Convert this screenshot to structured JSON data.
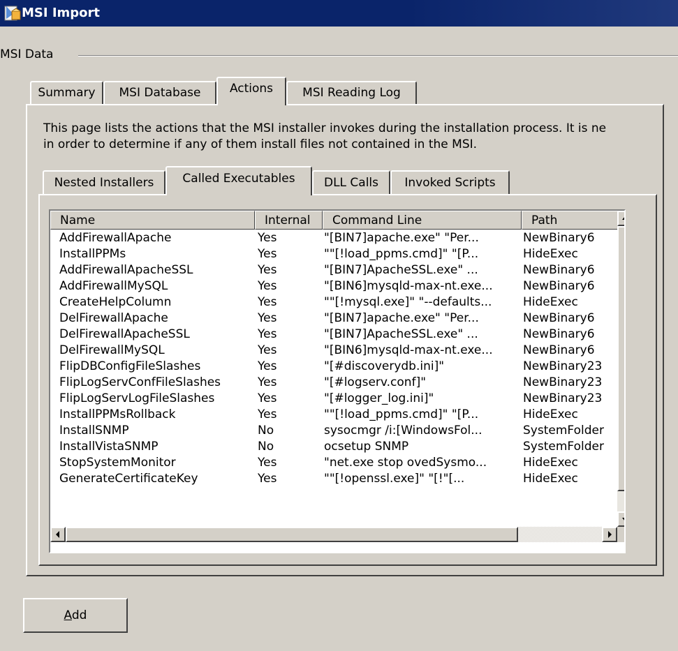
{
  "window": {
    "title": "MSI Import"
  },
  "groupbox": {
    "label": "MSI Data"
  },
  "outer_tabs": [
    {
      "label": "Summary",
      "selected": false
    },
    {
      "label": "MSI Database",
      "selected": false
    },
    {
      "label": "Actions",
      "selected": true
    },
    {
      "label": "MSI Reading Log",
      "selected": false
    }
  ],
  "description": {
    "line1": "This page lists the actions that the MSI installer invokes during the installation process.  It is ne",
    "line2": "in order to determine if any of them install files not contained in the MSI."
  },
  "inner_tabs": [
    {
      "label": "Nested Installers",
      "selected": false
    },
    {
      "label": "Called Executables",
      "selected": true
    },
    {
      "label": "DLL Calls",
      "selected": false
    },
    {
      "label": "Invoked Scripts",
      "selected": false
    }
  ],
  "table": {
    "columns": [
      "Name",
      "Internal",
      "Command Line",
      "Path"
    ],
    "rows": [
      [
        "AddFirewallApache",
        "Yes",
        "\"[BIN7]apache.exe\" \"Per...",
        "NewBinary6"
      ],
      [
        "InstallPPMs",
        "Yes",
        "\"\"[!load_ppms.cmd]\" \"[P...",
        "HideExec"
      ],
      [
        "AddFirewallApacheSSL",
        "Yes",
        "\"[BIN7]ApacheSSL.exe\" ...",
        "NewBinary6"
      ],
      [
        "AddFirewallMySQL",
        "Yes",
        "\"[BIN6]mysqld-max-nt.exe...",
        "NewBinary6"
      ],
      [
        "CreateHelpColumn",
        "Yes",
        "\"\"[!mysql.exe]\" \"--defaults...",
        "HideExec"
      ],
      [
        "DelFirewallApache",
        "Yes",
        "\"[BIN7]apache.exe\" \"Per...",
        "NewBinary6"
      ],
      [
        "DelFirewallApacheSSL",
        "Yes",
        "\"[BIN7]ApacheSSL.exe\" ...",
        "NewBinary6"
      ],
      [
        "DelFirewallMySQL",
        "Yes",
        "\"[BIN6]mysqld-max-nt.exe...",
        "NewBinary6"
      ],
      [
        "FlipDBConfigFileSlashes",
        "Yes",
        "\"[#discoverydb.ini]\"",
        "NewBinary23"
      ],
      [
        "FlipLogServConfFileSlashes",
        "Yes",
        "\"[#logserv.conf]\"",
        "NewBinary23"
      ],
      [
        "FlipLogServLogFileSlashes",
        "Yes",
        "\"[#logger_log.ini]\"",
        "NewBinary23"
      ],
      [
        "InstallPPMsRollback",
        "Yes",
        "\"\"[!load_ppms.cmd]\" \"[P...",
        "HideExec"
      ],
      [
        "InstallSNMP",
        "No",
        "sysocmgr /i:[WindowsFol...",
        "SystemFolder"
      ],
      [
        "InstallVistaSNMP",
        "No",
        "ocsetup SNMP",
        "SystemFolder"
      ],
      [
        "StopSystemMonitor",
        "Yes",
        "\"net.exe stop ovedSysmo...",
        "HideExec"
      ],
      [
        "GenerateCertificateKey",
        "Yes",
        "\"\"[!openssl.exe]\" \"[!\"[...",
        "HideExec"
      ]
    ],
    "vscroll_position": 0.0,
    "hscroll_position": 0.0
  },
  "buttons": {
    "add_label": "Add",
    "add_mnemonic": "A",
    "add_rest": "dd"
  },
  "icons": {
    "window": "msi-package-icon",
    "scroll_up": "triangle-up-icon",
    "scroll_down": "triangle-down-icon",
    "scroll_left": "triangle-left-icon",
    "scroll_right": "triangle-right-icon"
  },
  "colors": {
    "titlebar": "#0a246a",
    "face": "#d4d0c8",
    "list_bg": "#ffffff"
  }
}
